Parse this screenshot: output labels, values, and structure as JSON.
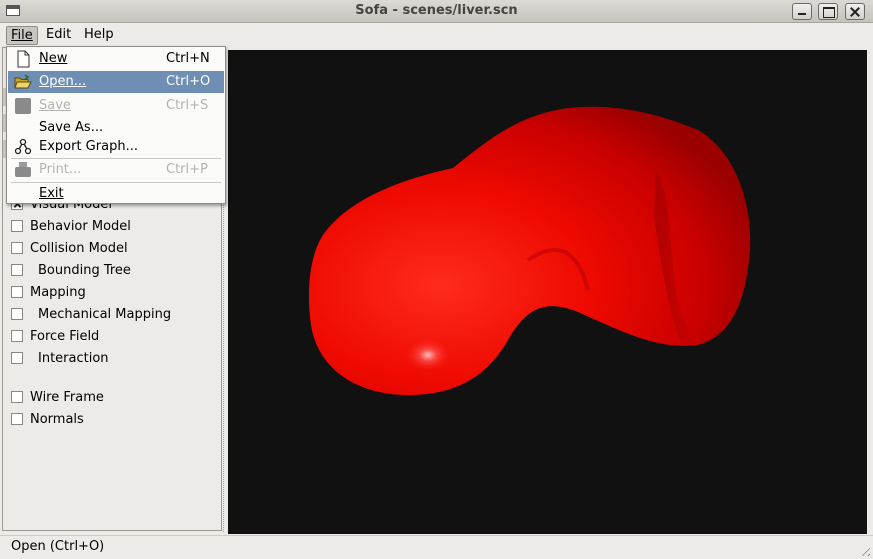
{
  "window": {
    "title": "Sofa - scenes/liver.scn"
  },
  "menubar": {
    "file": "File",
    "edit": "Edit",
    "help": "Help"
  },
  "file_menu": {
    "new": {
      "label": "New",
      "shortcut": "Ctrl+N"
    },
    "open": {
      "label": "Open...",
      "shortcut": "Ctrl+O"
    },
    "save": {
      "label": "Save",
      "shortcut": "Ctrl+S"
    },
    "save_as": {
      "label": "Save As..."
    },
    "export_graph": {
      "label": "Export Graph..."
    },
    "print": {
      "label": "Print...",
      "shortcut": "Ctrl+P"
    },
    "exit": {
      "label": "Exit"
    }
  },
  "display_flags": {
    "visual_model": {
      "label": "Visual Model",
      "checked": true
    },
    "behavior_model": {
      "label": "Behavior Model",
      "checked": false
    },
    "collision_model": {
      "label": "Collision Model",
      "checked": false
    },
    "bounding_tree": {
      "label": "Bounding Tree",
      "checked": false
    },
    "mapping": {
      "label": "Mapping",
      "checked": false
    },
    "mechanical_mapping": {
      "label": "Mechanical Mapping",
      "checked": false
    },
    "force_field": {
      "label": "Force Field",
      "checked": false
    },
    "interaction": {
      "label": "Interaction",
      "checked": false
    },
    "wire_frame": {
      "label": "Wire Frame",
      "checked": false
    },
    "normals": {
      "label": "Normals",
      "checked": false
    }
  },
  "statusbar": {
    "text": "Open (Ctrl+O)"
  },
  "colors": {
    "viewer_bg": "#111111",
    "model": "#e80000",
    "highlight": "#6e8fb3"
  },
  "icons": {
    "new": "new-document-icon",
    "open": "open-folder-icon",
    "save": "save-icon",
    "export": "graph-icon",
    "print": "printer-icon"
  }
}
